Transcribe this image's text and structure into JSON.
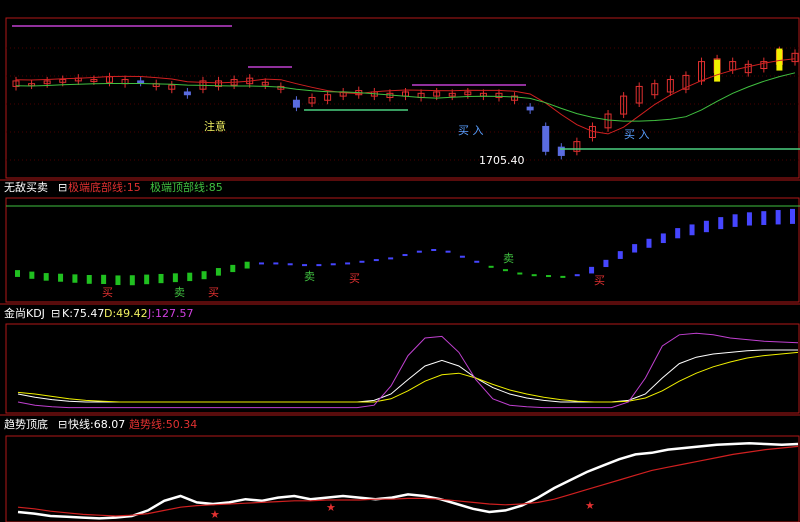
{
  "colors": {
    "bg": "#000000",
    "frame": "#b01818",
    "up": "#e03030",
    "down": "#5a6ce0",
    "ma_red": "#d02020",
    "ma_green": "#40c040",
    "flat_green": "#4bd080",
    "magenta": "#c040d0",
    "yellow": "#f0f000",
    "grid": "#4a0000",
    "white": "#ffffff",
    "blue_bar": "#4646ff",
    "green_bar": "#20c020"
  },
  "main": {
    "note_label": "注意",
    "buy_label_1": "买 入",
    "buy_label_2": "买 入",
    "low_label": "1705.40"
  },
  "pane1": {
    "title": "无敌买卖",
    "line1_label": "极端底部线:15",
    "line2_label": "极端顶部线:85",
    "sell_label": "卖",
    "buy_label": "买"
  },
  "pane2": {
    "title": "金尚KDJ",
    "k_label": "K:75.47",
    "d_label": "D:49.42",
    "j_label": "J:127.57"
  },
  "pane3": {
    "title": "趋势顶底",
    "fast_label": "快线:68.07",
    "trend_label": "趋势线:50.34"
  },
  "chart_data": [
    {
      "type": "candlestick",
      "title": "",
      "annotations": [
        "注意",
        "买 入",
        "买 入",
        "1705.40"
      ],
      "price_points": [
        {
          "x": 0,
          "o": 0.62,
          "c": 0.66
        },
        {
          "x": 1,
          "o": 0.63,
          "c": 0.64
        },
        {
          "x": 2,
          "o": 0.64,
          "c": 0.66
        },
        {
          "x": 3,
          "o": 0.65,
          "c": 0.67
        },
        {
          "x": 4,
          "o": 0.66,
          "c": 0.68
        },
        {
          "x": 5,
          "o": 0.66,
          "c": 0.67
        },
        {
          "x": 6,
          "o": 0.65,
          "c": 0.69
        },
        {
          "x": 7,
          "o": 0.64,
          "c": 0.67
        },
        {
          "x": 8,
          "o": 0.66,
          "c": 0.65
        },
        {
          "x": 9,
          "o": 0.62,
          "c": 0.64
        },
        {
          "x": 10,
          "o": 0.6,
          "c": 0.63
        },
        {
          "x": 11,
          "o": 0.58,
          "c": 0.56
        },
        {
          "x": 12,
          "o": 0.6,
          "c": 0.66
        },
        {
          "x": 13,
          "o": 0.62,
          "c": 0.66
        },
        {
          "x": 14,
          "o": 0.63,
          "c": 0.67
        },
        {
          "x": 15,
          "o": 0.64,
          "c": 0.68
        },
        {
          "x": 16,
          "o": 0.63,
          "c": 0.65
        },
        {
          "x": 17,
          "o": 0.6,
          "c": 0.62
        },
        {
          "x": 18,
          "o": 0.52,
          "c": 0.47
        },
        {
          "x": 19,
          "o": 0.5,
          "c": 0.54
        },
        {
          "x": 20,
          "o": 0.52,
          "c": 0.56
        },
        {
          "x": 21,
          "o": 0.55,
          "c": 0.58
        },
        {
          "x": 22,
          "o": 0.56,
          "c": 0.59
        },
        {
          "x": 23,
          "o": 0.55,
          "c": 0.58
        },
        {
          "x": 24,
          "o": 0.54,
          "c": 0.57
        },
        {
          "x": 25,
          "o": 0.55,
          "c": 0.58
        },
        {
          "x": 26,
          "o": 0.54,
          "c": 0.57
        },
        {
          "x": 27,
          "o": 0.55,
          "c": 0.58
        },
        {
          "x": 28,
          "o": 0.55,
          "c": 0.57
        },
        {
          "x": 29,
          "o": 0.56,
          "c": 0.58
        },
        {
          "x": 30,
          "o": 0.55,
          "c": 0.57
        },
        {
          "x": 31,
          "o": 0.54,
          "c": 0.57
        },
        {
          "x": 32,
          "o": 0.52,
          "c": 0.55
        },
        {
          "x": 33,
          "o": 0.47,
          "c": 0.45
        },
        {
          "x": 34,
          "o": 0.33,
          "c": 0.15
        },
        {
          "x": 35,
          "o": 0.18,
          "c": 0.12
        },
        {
          "x": 36,
          "o": 0.15,
          "c": 0.22
        },
        {
          "x": 37,
          "o": 0.25,
          "c": 0.33
        },
        {
          "x": 38,
          "o": 0.32,
          "c": 0.42
        },
        {
          "x": 39,
          "o": 0.42,
          "c": 0.55
        },
        {
          "x": 40,
          "o": 0.5,
          "c": 0.62
        },
        {
          "x": 41,
          "o": 0.56,
          "c": 0.64
        },
        {
          "x": 42,
          "o": 0.58,
          "c": 0.67
        },
        {
          "x": 43,
          "o": 0.6,
          "c": 0.7
        },
        {
          "x": 44,
          "o": 0.66,
          "c": 0.8
        },
        {
          "x": 45,
          "o": 0.72,
          "c": 0.82
        },
        {
          "x": 46,
          "o": 0.74,
          "c": 0.8
        },
        {
          "x": 47,
          "o": 0.72,
          "c": 0.78
        },
        {
          "x": 48,
          "o": 0.75,
          "c": 0.8
        },
        {
          "x": 49,
          "o": 0.78,
          "c": 0.88
        },
        {
          "x": 50,
          "o": 0.8,
          "c": 0.86
        }
      ]
    },
    {
      "type": "bar",
      "title": "无敌买卖",
      "legend": [
        "极端底部线:15",
        "极端顶部线:85"
      ],
      "values": [
        22,
        20,
        18,
        17,
        16,
        15,
        15,
        14,
        14,
        15,
        16,
        17,
        18,
        20,
        24,
        28,
        32,
        34,
        34,
        33,
        32,
        32,
        33,
        34,
        36,
        38,
        40,
        44,
        48,
        50,
        48,
        42,
        36,
        30,
        26,
        22,
        20,
        19,
        18,
        20,
        26,
        34,
        44,
        52,
        58,
        64,
        70,
        74,
        78,
        82,
        85,
        87,
        88,
        89,
        90
      ]
    },
    {
      "type": "line",
      "title": "金尚KDJ",
      "series": [
        {
          "name": "K:75.47",
          "values": [
            20,
            16,
            13,
            11,
            10,
            10,
            10,
            10,
            10,
            10,
            10,
            10,
            10,
            10,
            10,
            10,
            10,
            10,
            10,
            10,
            10,
            12,
            20,
            38,
            55,
            62,
            55,
            40,
            28,
            20,
            15,
            12,
            10,
            10,
            10,
            10,
            12,
            20,
            40,
            58,
            66,
            70,
            72,
            74,
            75,
            75,
            75
          ]
        },
        {
          "name": "D:49.42",
          "values": [
            22,
            20,
            17,
            14,
            12,
            11,
            10,
            10,
            10,
            10,
            10,
            10,
            10,
            10,
            10,
            10,
            10,
            10,
            10,
            10,
            10,
            10,
            14,
            24,
            36,
            44,
            46,
            40,
            32,
            25,
            20,
            16,
            13,
            11,
            10,
            10,
            11,
            15,
            24,
            36,
            46,
            54,
            60,
            65,
            68,
            70,
            72
          ]
        },
        {
          "name": "J:127.57",
          "values": [
            10,
            6,
            4,
            3,
            3,
            3,
            3,
            3,
            3,
            3,
            3,
            3,
            3,
            3,
            3,
            3,
            3,
            3,
            3,
            3,
            3,
            6,
            30,
            68,
            90,
            92,
            72,
            38,
            14,
            6,
            4,
            3,
            3,
            3,
            3,
            3,
            10,
            40,
            80,
            94,
            96,
            94,
            90,
            88,
            86,
            85,
            84
          ]
        }
      ]
    },
    {
      "type": "line",
      "title": "趋势顶底",
      "series": [
        {
          "name": "快线:68.07",
          "values": [
            10,
            8,
            5,
            4,
            3,
            2,
            3,
            5,
            12,
            24,
            30,
            22,
            20,
            22,
            26,
            24,
            28,
            30,
            26,
            28,
            30,
            28,
            26,
            28,
            32,
            30,
            26,
            20,
            14,
            10,
            12,
            18,
            28,
            40,
            50,
            60,
            68,
            76,
            82,
            84,
            88,
            90,
            92,
            94,
            95,
            96,
            95,
            94,
            95
          ]
        },
        {
          "name": "趋势线:50.34",
          "values": [
            16,
            14,
            11,
            9,
            7,
            6,
            5,
            6,
            8,
            12,
            16,
            18,
            19,
            20,
            21,
            22,
            23,
            24,
            24,
            25,
            25,
            25,
            26,
            26,
            27,
            27,
            26,
            24,
            22,
            20,
            19,
            20,
            22,
            26,
            32,
            38,
            44,
            50,
            56,
            62,
            66,
            70,
            74,
            78,
            82,
            85,
            88,
            90,
            92
          ]
        }
      ]
    }
  ]
}
